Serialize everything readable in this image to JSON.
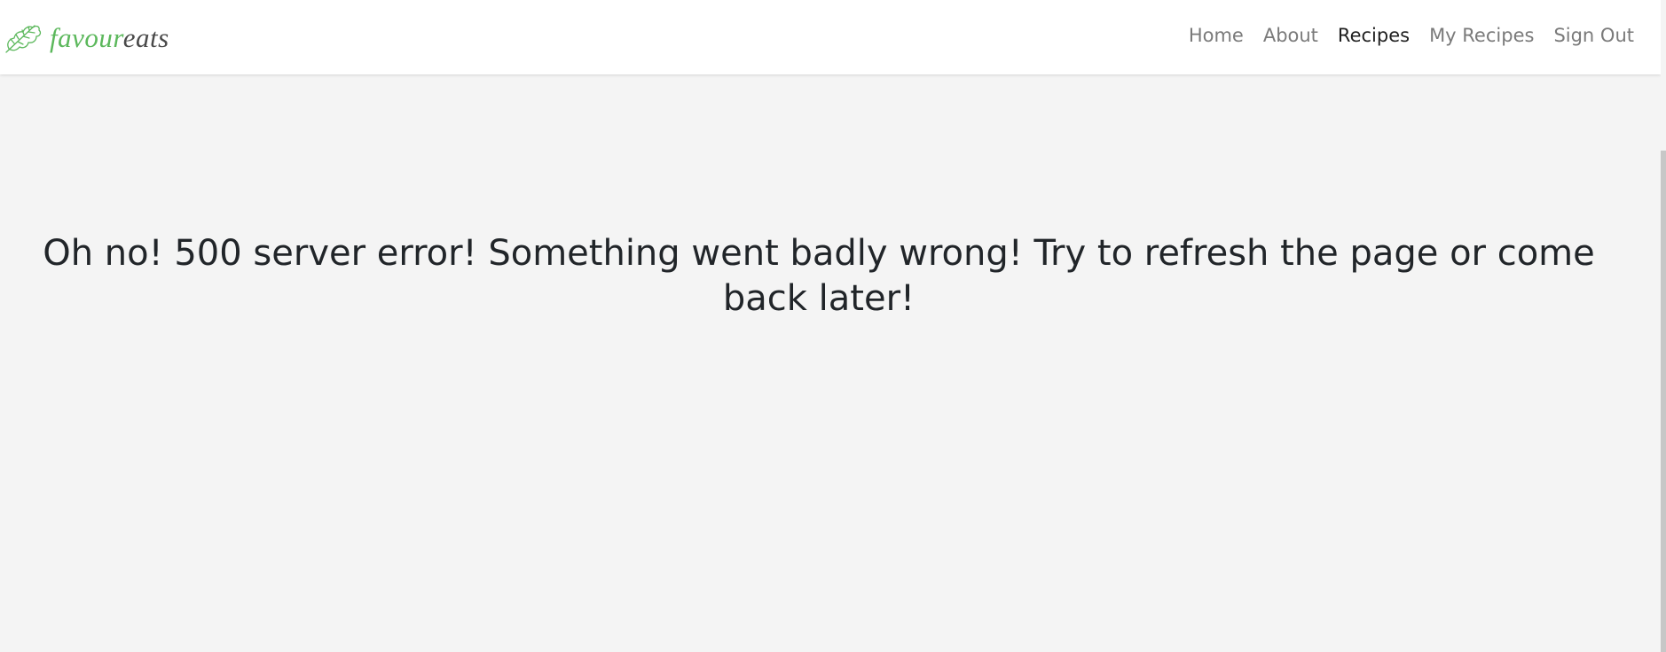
{
  "brand": {
    "name_part_1": "favour",
    "name_part_2": "eats",
    "logo_icon": "leaf-icon",
    "accent_color": "#5cb85c"
  },
  "nav": {
    "items": [
      {
        "label": "Home",
        "active": false
      },
      {
        "label": "About",
        "active": false
      },
      {
        "label": "Recipes",
        "active": true
      },
      {
        "label": "My Recipes",
        "active": false
      },
      {
        "label": "Sign Out",
        "active": false
      }
    ]
  },
  "main": {
    "error_message": "Oh no! 500 server error! Something went badly wrong! Try to refresh the page or come back later!"
  }
}
